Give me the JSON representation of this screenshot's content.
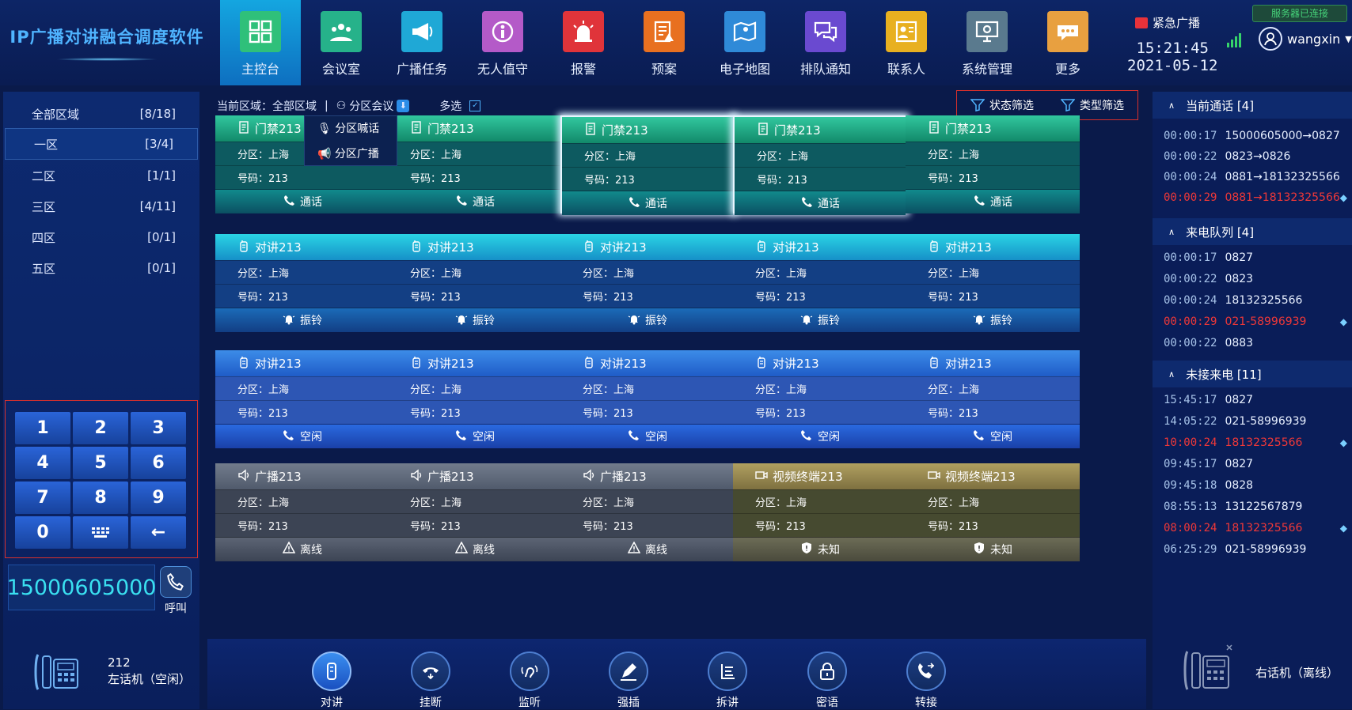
{
  "app": {
    "title": "IP广播对讲融合调度软件"
  },
  "nav": [
    {
      "label": "主控台",
      "icon": "grid-icon",
      "color": "#2fc07a",
      "active": true
    },
    {
      "label": "会议室",
      "icon": "meeting-icon",
      "color": "#26b28a"
    },
    {
      "label": "广播任务",
      "icon": "megaphone-icon",
      "color": "#1fa8d6"
    },
    {
      "label": "无人值守",
      "icon": "unattended-icon",
      "color": "#b45ac8"
    },
    {
      "label": "报警",
      "icon": "alarm-icon",
      "color": "#e0343a"
    },
    {
      "label": "预案",
      "icon": "plan-icon",
      "color": "#e87020"
    },
    {
      "label": "电子地图",
      "icon": "map-icon",
      "color": "#2f8ad8"
    },
    {
      "label": "排队通知",
      "icon": "queue-icon",
      "color": "#6a4ad0"
    },
    {
      "label": "联系人",
      "icon": "contacts-icon",
      "color": "#e8b020"
    },
    {
      "label": "系统管理",
      "icon": "system-icon",
      "color": "#5a7a8e"
    },
    {
      "label": "更多",
      "icon": "more-icon",
      "color": "#e8a040"
    }
  ],
  "header": {
    "emergency": "紧急广播",
    "time": "15:21:45",
    "date": "2021-05-12",
    "server_status": "服务器已连接",
    "user": "wangxin"
  },
  "zones": [
    {
      "name": "全部区域",
      "count": "[8/18]"
    },
    {
      "name": "一区",
      "count": "[3/4]",
      "selected": true
    },
    {
      "name": "二区",
      "count": "[1/1]"
    },
    {
      "name": "三区",
      "count": "[4/11]"
    },
    {
      "name": "四区",
      "count": "[0/1]"
    },
    {
      "name": "五区",
      "count": "[0/1]"
    }
  ],
  "keypad": [
    "1",
    "2",
    "3",
    "4",
    "5",
    "6",
    "7",
    "8",
    "9",
    "0",
    "keypad-icon",
    "←"
  ],
  "dial": {
    "number": "15000605000",
    "call_label": "呼叫"
  },
  "left_phone": {
    "ext": "212",
    "status": "左话机（空闲）"
  },
  "toolbar": {
    "area": "当前区域：全部区域",
    "sep": "|",
    "partition_meeting": "分区会议",
    "multi": "多选",
    "status_filter": "状态筛选",
    "type_filter": "类型筛选",
    "menu": [
      "分区喊话",
      "分区广播"
    ]
  },
  "cards": [
    {
      "type": "t-green",
      "title": "门禁213",
      "zone": "分区：上海",
      "num": "号码：213",
      "status": "通话",
      "icon": "door-icon",
      "sicon": "phone"
    },
    {
      "type": "t-green",
      "title": "门禁213",
      "zone": "分区：上海",
      "num": "号码：213",
      "status": "通话",
      "icon": "door-icon",
      "sicon": "phone"
    },
    {
      "type": "t-green glow",
      "title": "门禁213",
      "zone": "分区：上海",
      "num": "号码：213",
      "status": "通话",
      "icon": "door-icon",
      "sicon": "phone"
    },
    {
      "type": "t-green glow",
      "title": "门禁213",
      "zone": "分区：上海",
      "num": "号码：213",
      "status": "通话",
      "icon": "door-icon",
      "sicon": "phone"
    },
    {
      "type": "t-green",
      "title": "门禁213",
      "zone": "分区：上海",
      "num": "号码：213",
      "status": "通话",
      "icon": "door-icon",
      "sicon": "phone"
    },
    {
      "type": "t-cyan",
      "title": "对讲213",
      "zone": "分区：上海",
      "num": "号码：213",
      "status": "振铃",
      "icon": "intercom-icon",
      "sicon": "bell"
    },
    {
      "type": "t-cyan",
      "title": "对讲213",
      "zone": "分区：上海",
      "num": "号码：213",
      "status": "振铃",
      "icon": "intercom-icon",
      "sicon": "bell"
    },
    {
      "type": "t-cyan",
      "title": "对讲213",
      "zone": "分区：上海",
      "num": "号码：213",
      "status": "振铃",
      "icon": "intercom-icon",
      "sicon": "bell"
    },
    {
      "type": "t-cyan",
      "title": "对讲213",
      "zone": "分区：上海",
      "num": "号码：213",
      "status": "振铃",
      "icon": "intercom-icon",
      "sicon": "bell"
    },
    {
      "type": "t-cyan",
      "title": "对讲213",
      "zone": "分区：上海",
      "num": "号码：213",
      "status": "振铃",
      "icon": "intercom-icon",
      "sicon": "bell"
    },
    {
      "type": "t-blue",
      "title": "对讲213",
      "zone": "分区：上海",
      "num": "号码：213",
      "status": "空闲",
      "icon": "intercom-icon",
      "sicon": "handset"
    },
    {
      "type": "t-blue",
      "title": "对讲213",
      "zone": "分区：上海",
      "num": "号码：213",
      "status": "空闲",
      "icon": "intercom-icon",
      "sicon": "handset"
    },
    {
      "type": "t-blue",
      "title": "对讲213",
      "zone": "分区：上海",
      "num": "号码：213",
      "status": "空闲",
      "icon": "intercom-icon",
      "sicon": "handset"
    },
    {
      "type": "t-blue",
      "title": "对讲213",
      "zone": "分区：上海",
      "num": "号码：213",
      "status": "空闲",
      "icon": "intercom-icon",
      "sicon": "handset"
    },
    {
      "type": "t-blue",
      "title": "对讲213",
      "zone": "分区：上海",
      "num": "号码：213",
      "status": "空闲",
      "icon": "intercom-icon",
      "sicon": "handset"
    },
    {
      "type": "t-gray",
      "title": "广播213",
      "zone": "分区：上海",
      "num": "号码：213",
      "status": "离线",
      "icon": "speaker-icon",
      "sicon": "warn"
    },
    {
      "type": "t-gray",
      "title": "广播213",
      "zone": "分区：上海",
      "num": "号码：213",
      "status": "离线",
      "icon": "speaker-icon",
      "sicon": "warn"
    },
    {
      "type": "t-gray",
      "title": "广播213",
      "zone": "分区：上海",
      "num": "号码：213",
      "status": "离线",
      "icon": "speaker-icon",
      "sicon": "warn"
    },
    {
      "type": "t-olive",
      "title": "视频终端213",
      "zone": "分区：上海",
      "num": "号码：213",
      "status": "未知",
      "icon": "camera-icon",
      "sicon": "shield"
    },
    {
      "type": "t-olive",
      "title": "视频终端213",
      "zone": "分区：上海",
      "num": "号码：213",
      "status": "未知",
      "icon": "camera-icon",
      "sicon": "shield"
    }
  ],
  "actions": [
    {
      "label": "对讲",
      "icon": "intercom-icon",
      "alt": false
    },
    {
      "label": "挂断",
      "icon": "hangup-icon",
      "alt": true
    },
    {
      "label": "监听",
      "icon": "listen-icon",
      "alt": true
    },
    {
      "label": "强插",
      "icon": "pen-icon",
      "alt": true
    },
    {
      "label": "拆讲",
      "icon": "split-icon",
      "alt": true
    },
    {
      "label": "密语",
      "icon": "lock-icon",
      "alt": true
    },
    {
      "label": "转接",
      "icon": "transfer-icon",
      "alt": true
    }
  ],
  "current_calls": {
    "title": "当前通话 [4]",
    "items": [
      {
        "time": "00:00:17",
        "text": "15000605000→0827"
      },
      {
        "time": "00:00:22",
        "text": "0823→0826"
      },
      {
        "time": "00:00:24",
        "text": "0881→18132325566"
      },
      {
        "time": "00:00:29",
        "text": "0881→18132325566",
        "red": true,
        "mark": true
      }
    ]
  },
  "incoming_queue": {
    "title": "来电队列 [4]",
    "items": [
      {
        "time": "00:00:17",
        "text": "0827"
      },
      {
        "time": "00:00:22",
        "text": "0823"
      },
      {
        "time": "00:00:24",
        "text": "18132325566"
      },
      {
        "time": "00:00:29",
        "text": "021-58996939",
        "red": true,
        "mark": true
      },
      {
        "time": "00:00:22",
        "text": "0883"
      }
    ]
  },
  "missed_calls": {
    "title": "未接来电 [11]",
    "items": [
      {
        "time": "15:45:17",
        "text": "0827"
      },
      {
        "time": "14:05:22",
        "text": "021-58996939"
      },
      {
        "time": "10:00:24",
        "text": "18132325566",
        "red": true,
        "mark": true
      },
      {
        "time": "09:45:17",
        "text": "0827"
      },
      {
        "time": "09:45:18",
        "text": "0828"
      },
      {
        "time": "08:55:13",
        "text": "13122567879"
      },
      {
        "time": "08:00:24",
        "text": "18132325566",
        "red": true,
        "mark": true
      },
      {
        "time": "06:25:29",
        "text": "021-58996939"
      }
    ]
  },
  "right_phone": {
    "status": "右话机（离线）"
  }
}
